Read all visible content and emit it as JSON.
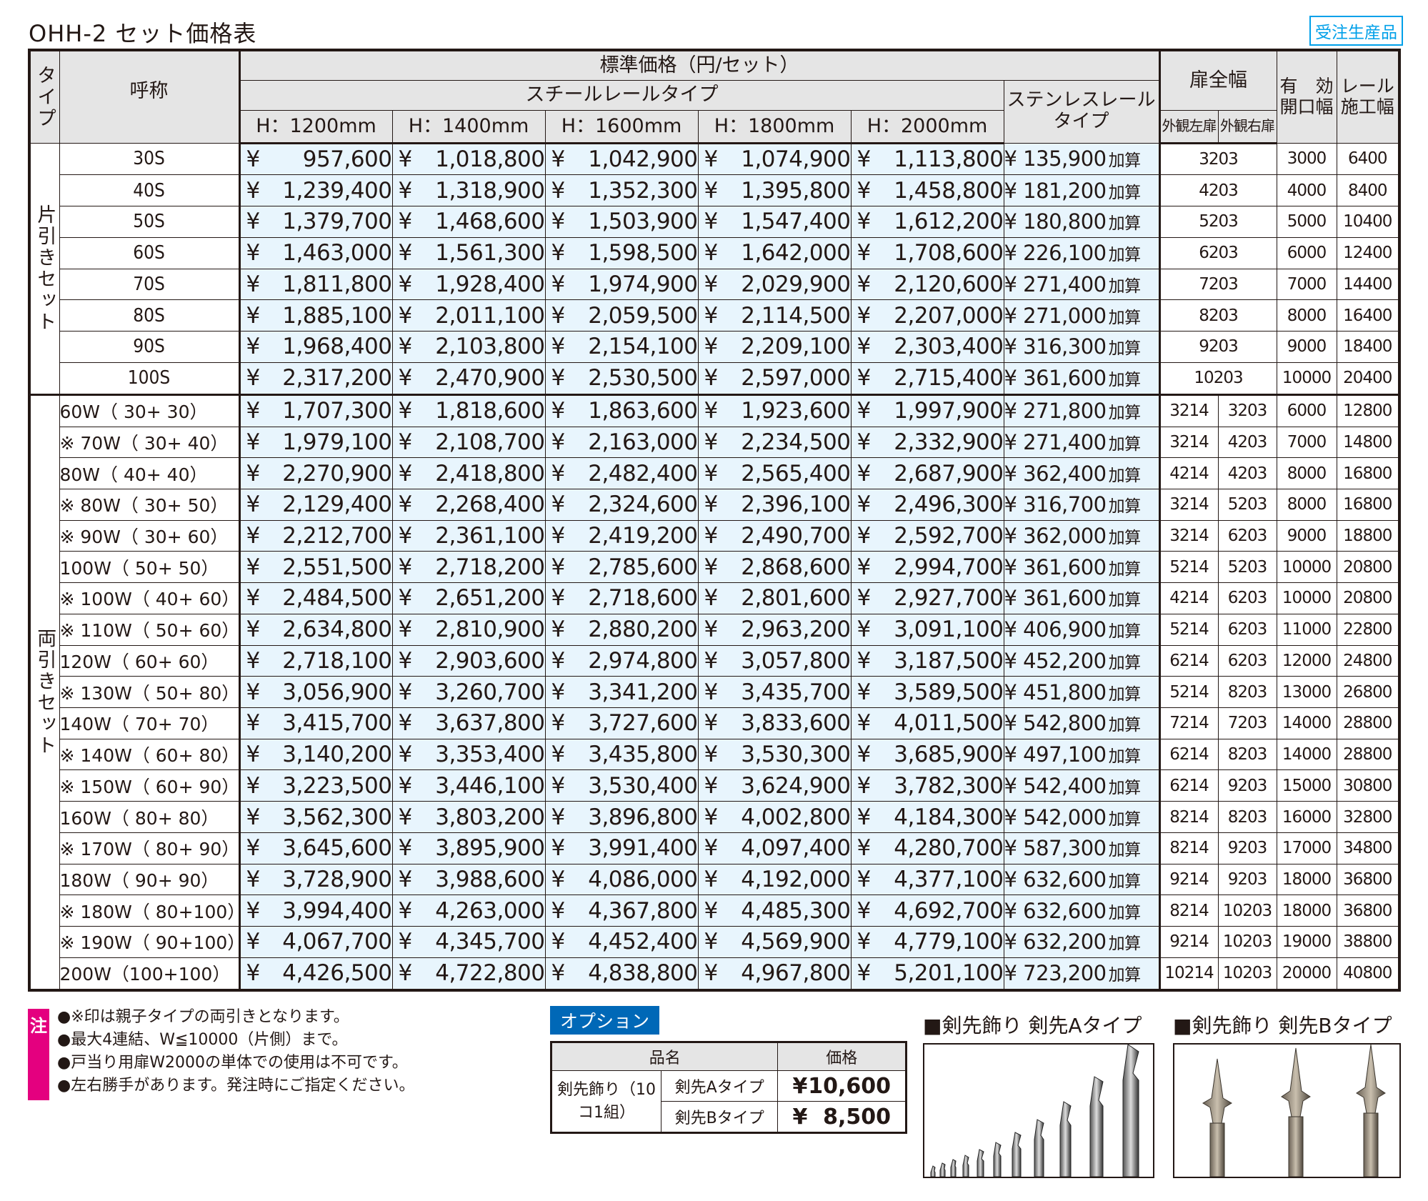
{
  "title": "OHH-2 セット価格表",
  "badge": "受注生産品",
  "header": {
    "type": "タイプ",
    "name": "呼称",
    "std_price": "標準価格（円/セット）",
    "steel": "スチールレールタイプ",
    "stainless": "ステンレスレールタイプ",
    "heights": [
      "H：1200mm",
      "H：1400mm",
      "H：1600mm",
      "H：1800mm",
      "H：2000mm"
    ],
    "door_width": "扉全幅",
    "left_door": "外観左扉",
    "right_door": "外観右扉",
    "effective": "有　効開口幅",
    "rail": "レール施工幅"
  },
  "yen": "¥",
  "add_label": "加算",
  "groups": {
    "single": "片引きセット",
    "double": "両引きセット"
  },
  "single_rows": [
    {
      "name": "30S",
      "p": [
        "957,600",
        "1,018,800",
        "1,042,900",
        "1,074,900",
        "1,113,800"
      ],
      "sus": "135,900",
      "w": "3203",
      "open": "3000",
      "rail": "6400"
    },
    {
      "name": "40S",
      "p": [
        "1,239,400",
        "1,318,900",
        "1,352,300",
        "1,395,800",
        "1,458,800"
      ],
      "sus": "181,200",
      "w": "4203",
      "open": "4000",
      "rail": "8400"
    },
    {
      "name": "50S",
      "p": [
        "1,379,700",
        "1,468,600",
        "1,503,900",
        "1,547,400",
        "1,612,200"
      ],
      "sus": "180,800",
      "w": "5203",
      "open": "5000",
      "rail": "10400"
    },
    {
      "name": "60S",
      "p": [
        "1,463,000",
        "1,561,300",
        "1,598,500",
        "1,642,000",
        "1,708,600"
      ],
      "sus": "226,100",
      "w": "6203",
      "open": "6000",
      "rail": "12400"
    },
    {
      "name": "70S",
      "p": [
        "1,811,800",
        "1,928,400",
        "1,974,900",
        "2,029,900",
        "2,120,600"
      ],
      "sus": "271,400",
      "w": "7203",
      "open": "7000",
      "rail": "14400"
    },
    {
      "name": "80S",
      "p": [
        "1,885,100",
        "2,011,100",
        "2,059,500",
        "2,114,500",
        "2,207,000"
      ],
      "sus": "271,000",
      "w": "8203",
      "open": "8000",
      "rail": "16400"
    },
    {
      "name": "90S",
      "p": [
        "1,968,400",
        "2,103,800",
        "2,154,100",
        "2,209,100",
        "2,303,400"
      ],
      "sus": "316,300",
      "w": "9203",
      "open": "9000",
      "rail": "18400"
    },
    {
      "name": "100S",
      "p": [
        "2,317,200",
        "2,470,900",
        "2,530,500",
        "2,597,000",
        "2,715,400"
      ],
      "sus": "361,600",
      "w": "10203",
      "open": "10000",
      "rail": "20400"
    }
  ],
  "double_rows": [
    {
      "name": "   60W（ 30+ 30）",
      "p": [
        "1,707,300",
        "1,818,600",
        "1,863,600",
        "1,923,600",
        "1,997,900"
      ],
      "sus": "271,800",
      "l": "3214",
      "r": "3203",
      "open": "6000",
      "rail": "12800"
    },
    {
      "name": "※  70W（ 30+ 40）",
      "p": [
        "1,979,100",
        "2,108,700",
        "2,163,000",
        "2,234,500",
        "2,332,900"
      ],
      "sus": "271,400",
      "l": "3214",
      "r": "4203",
      "open": "7000",
      "rail": "14800"
    },
    {
      "name": "   80W（ 40+ 40）",
      "p": [
        "2,270,900",
        "2,418,800",
        "2,482,400",
        "2,565,400",
        "2,687,900"
      ],
      "sus": "362,400",
      "l": "4214",
      "r": "4203",
      "open": "8000",
      "rail": "16800"
    },
    {
      "name": "※  80W（ 30+ 50）",
      "p": [
        "2,129,400",
        "2,268,400",
        "2,324,600",
        "2,396,100",
        "2,496,300"
      ],
      "sus": "316,700",
      "l": "3214",
      "r": "5203",
      "open": "8000",
      "rail": "16800"
    },
    {
      "name": "※  90W（ 30+ 60）",
      "p": [
        "2,212,700",
        "2,361,100",
        "2,419,200",
        "2,490,700",
        "2,592,700"
      ],
      "sus": "362,000",
      "l": "3214",
      "r": "6203",
      "open": "9000",
      "rail": "18800"
    },
    {
      "name": "  100W（ 50+ 50）",
      "p": [
        "2,551,500",
        "2,718,200",
        "2,785,600",
        "2,868,600",
        "2,994,700"
      ],
      "sus": "361,600",
      "l": "5214",
      "r": "5203",
      "open": "10000",
      "rail": "20800"
    },
    {
      "name": "※ 100W（ 40+ 60）",
      "p": [
        "2,484,500",
        "2,651,200",
        "2,718,600",
        "2,801,600",
        "2,927,700"
      ],
      "sus": "361,600",
      "l": "4214",
      "r": "6203",
      "open": "10000",
      "rail": "20800"
    },
    {
      "name": "※ 110W（ 50+ 60）",
      "p": [
        "2,634,800",
        "2,810,900",
        "2,880,200",
        "2,963,200",
        "3,091,100"
      ],
      "sus": "406,900",
      "l": "5214",
      "r": "6203",
      "open": "11000",
      "rail": "22800"
    },
    {
      "name": "  120W（ 60+ 60）",
      "p": [
        "2,718,100",
        "2,903,600",
        "2,974,800",
        "3,057,800",
        "3,187,500"
      ],
      "sus": "452,200",
      "l": "6214",
      "r": "6203",
      "open": "12000",
      "rail": "24800"
    },
    {
      "name": "※ 130W（ 50+ 80）",
      "p": [
        "3,056,900",
        "3,260,700",
        "3,341,200",
        "3,435,700",
        "3,589,500"
      ],
      "sus": "451,800",
      "l": "5214",
      "r": "8203",
      "open": "13000",
      "rail": "26800"
    },
    {
      "name": "  140W（ 70+ 70）",
      "p": [
        "3,415,700",
        "3,637,800",
        "3,727,600",
        "3,833,600",
        "4,011,500"
      ],
      "sus": "542,800",
      "l": "7214",
      "r": "7203",
      "open": "14000",
      "rail": "28800"
    },
    {
      "name": "※ 140W（ 60+ 80）",
      "p": [
        "3,140,200",
        "3,353,400",
        "3,435,800",
        "3,530,300",
        "3,685,900"
      ],
      "sus": "497,100",
      "l": "6214",
      "r": "8203",
      "open": "14000",
      "rail": "28800"
    },
    {
      "name": "※ 150W（ 60+ 90）",
      "p": [
        "3,223,500",
        "3,446,100",
        "3,530,400",
        "3,624,900",
        "3,782,300"
      ],
      "sus": "542,400",
      "l": "6214",
      "r": "9203",
      "open": "15000",
      "rail": "30800"
    },
    {
      "name": "  160W（ 80+ 80）",
      "p": [
        "3,562,300",
        "3,803,200",
        "3,896,800",
        "4,002,800",
        "4,184,300"
      ],
      "sus": "542,000",
      "l": "8214",
      "r": "8203",
      "open": "16000",
      "rail": "32800"
    },
    {
      "name": "※ 170W（ 80+ 90）",
      "p": [
        "3,645,600",
        "3,895,900",
        "3,991,400",
        "4,097,400",
        "4,280,700"
      ],
      "sus": "587,300",
      "l": "8214",
      "r": "9203",
      "open": "17000",
      "rail": "34800"
    },
    {
      "name": "  180W（ 90+ 90）",
      "p": [
        "3,728,900",
        "3,988,600",
        "4,086,000",
        "4,192,000",
        "4,377,100"
      ],
      "sus": "632,600",
      "l": "9214",
      "r": "9203",
      "open": "18000",
      "rail": "36800"
    },
    {
      "name": "※ 180W（ 80+100）",
      "p": [
        "3,994,400",
        "4,263,000",
        "4,367,800",
        "4,485,300",
        "4,692,700"
      ],
      "sus": "632,600",
      "l": "8214",
      "r": "10203",
      "open": "18000",
      "rail": "36800"
    },
    {
      "name": "※ 190W（ 90+100）",
      "p": [
        "4,067,700",
        "4,345,700",
        "4,452,400",
        "4,569,900",
        "4,779,100"
      ],
      "sus": "632,200",
      "l": "9214",
      "r": "10203",
      "open": "19000",
      "rail": "38800"
    },
    {
      "name": "  200W（100+100）",
      "p": [
        "4,426,500",
        "4,722,800",
        "4,838,800",
        "4,967,800",
        "5,201,100"
      ],
      "sus": "723,200",
      "l": "10214",
      "r": "10203",
      "open": "20000",
      "rail": "40800"
    }
  ],
  "notes": {
    "label": "注",
    "items": [
      "●※印は親子タイプの両引きとなります。",
      "●最大4連結、W≦10000（片側）まで。",
      "●戸当り用扉W2000の単体での使用は不可です。",
      "●左右勝手があります。発注時にご指定ください。"
    ]
  },
  "option": {
    "label": "オプション",
    "col_name": "品名",
    "col_price": "価格",
    "group": "剣先飾り（10コ1組）",
    "items": [
      {
        "name": "剣先Aタイプ",
        "price": "10,600"
      },
      {
        "name": "剣先Bタイプ",
        "price": "8,500"
      }
    ]
  },
  "pictures": {
    "a_title": "■剣先飾り 剣先Aタイプ",
    "b_title": "■剣先飾り 剣先Bタイプ"
  }
}
